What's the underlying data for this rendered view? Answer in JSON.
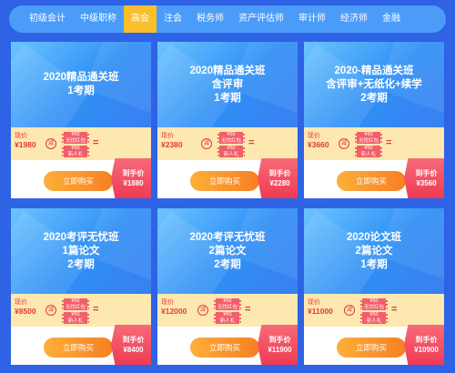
{
  "tabs": [
    {
      "label": "初级会计",
      "active": false
    },
    {
      "label": "中级职称",
      "active": false
    },
    {
      "label": "高会",
      "active": true
    },
    {
      "label": "注会",
      "active": false
    },
    {
      "label": "税务师",
      "active": false
    },
    {
      "label": "资产评估师",
      "active": false
    },
    {
      "label": "审计师",
      "active": false
    },
    {
      "label": "经济师",
      "active": false
    },
    {
      "label": "金融",
      "active": false
    }
  ],
  "colors": {
    "background": "#2e63e6",
    "tab_bar": "#4b9cf9",
    "active_tab": "#fbbf2b",
    "price_band": "#fde8b0",
    "buy_button": "#f77f23",
    "final_tag": "#ee3b54"
  },
  "common": {
    "orig_label": "现价",
    "minus_label": "减",
    "coupon1": "¥50\n无忧红包",
    "coupon2": "¥50\n新人礼",
    "equals": "=",
    "buy_label": "立即购买",
    "final_label": "到手价"
  },
  "cards": [
    {
      "title_lines": [
        "2020精品通关班",
        "1考期"
      ],
      "orig_price": "¥1980",
      "final_price": "¥1880"
    },
    {
      "title_lines": [
        "2020精品通关班",
        "含评审",
        "1考期"
      ],
      "orig_price": "¥2380",
      "final_price": "¥2280"
    },
    {
      "title_lines": [
        "2020-精品通关班",
        "含评审+无纸化+续学",
        "2考期"
      ],
      "orig_price": "¥3660",
      "final_price": "¥3560"
    },
    {
      "title_lines": [
        "2020考评无忧班",
        "1篇论文",
        "2考期"
      ],
      "orig_price": "¥8500",
      "final_price": "¥8400"
    },
    {
      "title_lines": [
        "2020考评无忧班",
        "2篇论文",
        "2考期"
      ],
      "orig_price": "¥12000",
      "final_price": "¥11900"
    },
    {
      "title_lines": [
        "2020论文班",
        "2篇论文",
        "1考期"
      ],
      "orig_price": "¥11000",
      "final_price": "¥10900"
    }
  ]
}
